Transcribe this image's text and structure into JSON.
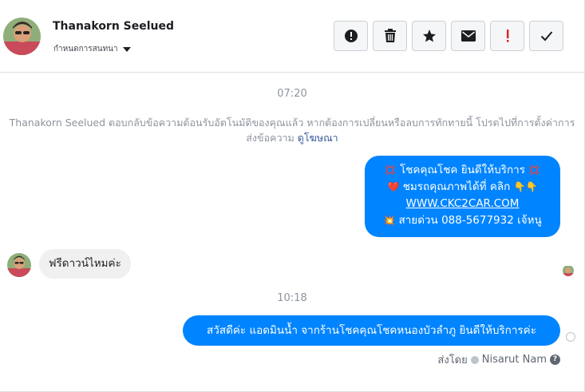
{
  "header": {
    "contact_name": "Thanakorn Seelued",
    "conversation_settings": "กำหนดการสนทนา",
    "toolbar": [
      {
        "icon": "alert-icon"
      },
      {
        "icon": "trash-icon"
      },
      {
        "icon": "star-icon"
      },
      {
        "icon": "mail-icon"
      },
      {
        "icon": "exclamation-icon",
        "color": "#e02020"
      },
      {
        "icon": "check-icon"
      }
    ]
  },
  "conversation": {
    "time_1": "07:20",
    "auto_reply_note": "Thanakorn Seelued ตอบกลับข้อความต้อนรับอัตโนมัติของคุณแล้ว หากต้องการเปลี่ยนหรือลบการทักทายนี้ โปรดไปที่การตั้งค่าการส่งข้อความ",
    "auto_reply_link": "ดูโฆษณา",
    "outgoing_1": {
      "line_1": "โชคคุณโชค ยินดีให้บริการ",
      "line_2": "ชมรถคุณภาพได้ที่   คลิก",
      "line_3": "WWW.CKC2CAR.COM",
      "line_4": "สายด่วน 088-5677932 เจ้หนู"
    },
    "incoming_1": "ฟรีดาวน์ไหมค่ะ",
    "time_2": "10:18",
    "outgoing_2": "สวัสดีค่ะ แอดมินน้ำ จากร้านโชคคุณโชคหนองบัวลำภู ยินดีให้บริการค่ะ",
    "sent_by_label": "ส่งโดย",
    "sent_by_name": "Nisarut Nam"
  },
  "colors": {
    "messenger_blue": "#0084ff",
    "incoming_gray": "#f1f0f0",
    "muted_text": "#8d949e",
    "link": "#385898"
  }
}
